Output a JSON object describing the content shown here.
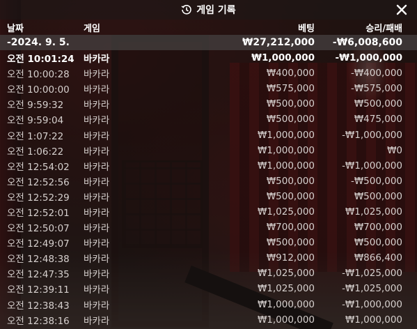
{
  "window": {
    "title": "게임 기록"
  },
  "header": {
    "date": "날짜",
    "game": "게임",
    "bet": "베팅",
    "result": "승리/패배"
  },
  "summary": {
    "date": "-2024. 9. 5.",
    "bet": "₩27,212,000",
    "result": "-₩6,008,600"
  },
  "rows": [
    {
      "time": "오전 10:01:24",
      "game": "바카라",
      "bet": "₩1,000,000",
      "result": "-₩1,000,000"
    },
    {
      "time": "오전 10:00:28",
      "game": "바카라",
      "bet": "₩400,000",
      "result": "-₩400,000"
    },
    {
      "time": "오전 10:00:00",
      "game": "바카라",
      "bet": "₩575,000",
      "result": "-₩575,000"
    },
    {
      "time": "오전 9:59:32",
      "game": "바카라",
      "bet": "₩500,000",
      "result": "₩500,000"
    },
    {
      "time": "오전 9:59:04",
      "game": "바카라",
      "bet": "₩500,000",
      "result": "₩475,000"
    },
    {
      "time": "오전 1:07:22",
      "game": "바카라",
      "bet": "₩1,000,000",
      "result": "-₩1,000,000"
    },
    {
      "time": "오전 1:06:22",
      "game": "바카라",
      "bet": "₩1,000,000",
      "result": "₩0"
    },
    {
      "time": "오전 12:54:02",
      "game": "바카라",
      "bet": "₩1,000,000",
      "result": "-₩1,000,000"
    },
    {
      "time": "오전 12:52:56",
      "game": "바카라",
      "bet": "₩500,000",
      "result": "-₩500,000"
    },
    {
      "time": "오전 12:52:29",
      "game": "바카라",
      "bet": "₩500,000",
      "result": "₩500,000"
    },
    {
      "time": "오전 12:52:01",
      "game": "바카라",
      "bet": "₩1,025,000",
      "result": "₩1,025,000"
    },
    {
      "time": "오전 12:50:07",
      "game": "바카라",
      "bet": "₩700,000",
      "result": "₩700,000"
    },
    {
      "time": "오전 12:49:07",
      "game": "바카라",
      "bet": "₩500,000",
      "result": "₩500,000"
    },
    {
      "time": "오전 12:48:38",
      "game": "바카라",
      "bet": "₩912,000",
      "result": "₩866,400"
    },
    {
      "time": "오전 12:47:35",
      "game": "바카라",
      "bet": "₩1,025,000",
      "result": "-₩1,025,000"
    },
    {
      "time": "오전 12:39:11",
      "game": "바카라",
      "bet": "₩1,025,000",
      "result": "-₩1,025,000"
    },
    {
      "time": "오전 12:38:43",
      "game": "바카라",
      "bet": "₩1,000,000",
      "result": "-₩1,000,000"
    },
    {
      "time": "오전 12:38:16",
      "game": "바카라",
      "bet": "₩1,000,000",
      "result": "₩1,000,000"
    }
  ],
  "icons": {
    "history": "history-icon",
    "close": "close-icon"
  },
  "colors": {
    "text": "#ffffff",
    "row_text": "#d6d0ce",
    "date_row_bg": "#464040"
  }
}
